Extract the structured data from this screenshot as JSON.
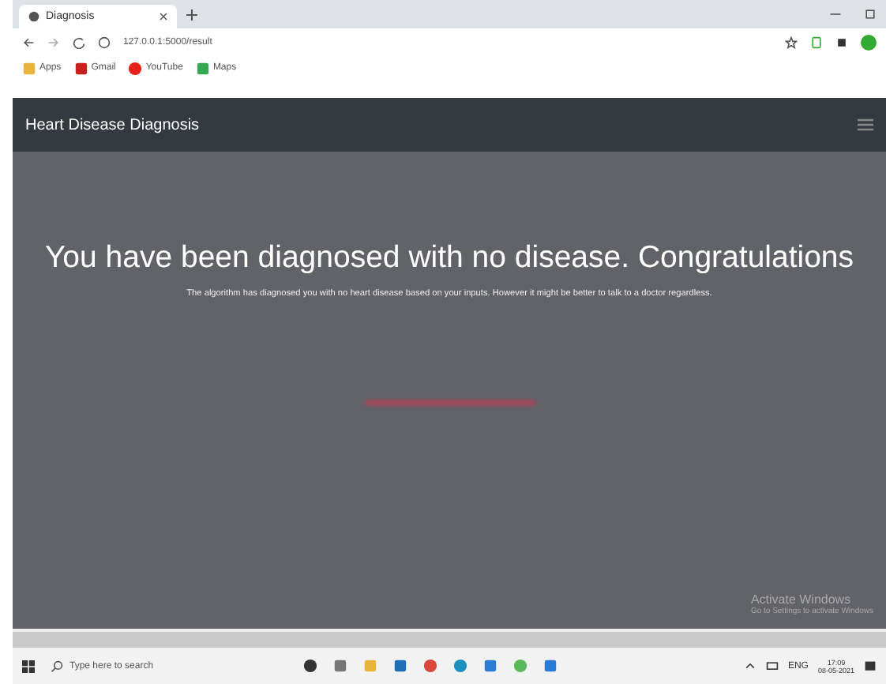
{
  "browser": {
    "tabs": [
      {
        "title": "Diagnosis",
        "selected": true
      }
    ],
    "url": "127.0.0.1:5000/result",
    "bookmarks": [
      "Apps",
      "Gmail",
      "YouTube",
      "Maps"
    ]
  },
  "navbar": {
    "brand": "Heart Disease Diagnosis"
  },
  "result": {
    "heading": "You have been diagnosed with no disease. Congratulations",
    "message": "The algorithm has diagnosed you with no heart disease based on your inputs. However it might be better to talk to a doctor regardless."
  },
  "activation": {
    "title": "Activate Windows",
    "subtitle": "Go to Settings to activate Windows"
  },
  "taskbar": {
    "search_placeholder": "Type here to search",
    "language": "ENG",
    "time": "17:09",
    "date": "08-05-2021"
  }
}
